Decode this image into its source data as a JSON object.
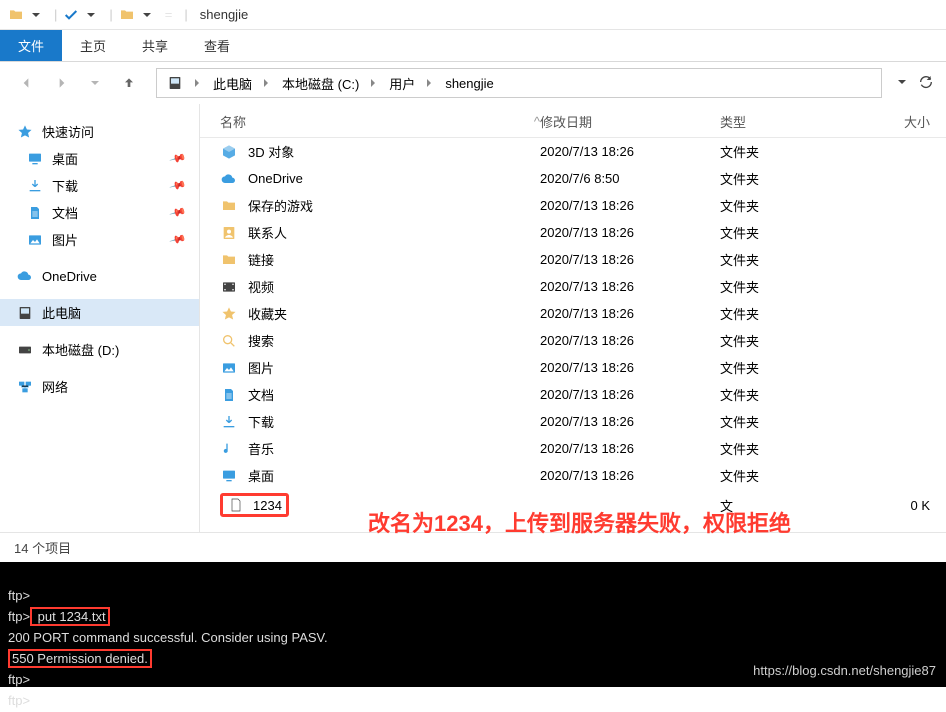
{
  "titlebar": {
    "title": "shengjie"
  },
  "tabs": {
    "file": "文件",
    "home": "主页",
    "share": "共享",
    "view": "查看"
  },
  "breadcrumb": {
    "segs": [
      "此电脑",
      "本地磁盘 (C:)",
      "用户",
      "shengjie"
    ]
  },
  "sidebar": {
    "quick": "快速访问",
    "pinned": {
      "desktop": "桌面",
      "downloads": "下载",
      "documents": "文档",
      "pictures": "图片"
    },
    "onedrive": "OneDrive",
    "thispc": "此电脑",
    "localdisk": "本地磁盘 (D:)",
    "network": "网络"
  },
  "columns": {
    "name": "名称",
    "date": "修改日期",
    "type": "类型",
    "size": "大小"
  },
  "rows": [
    {
      "icon": "cube",
      "name": "3D 对象",
      "date": "2020/7/13 18:26",
      "type": "文件夹"
    },
    {
      "icon": "cloud",
      "name": "OneDrive",
      "date": "2020/7/6 8:50",
      "type": "文件夹"
    },
    {
      "icon": "folder-g",
      "name": "保存的游戏",
      "date": "2020/7/13 18:26",
      "type": "文件夹"
    },
    {
      "icon": "contacts",
      "name": "联系人",
      "date": "2020/7/13 18:26",
      "type": "文件夹"
    },
    {
      "icon": "folder",
      "name": "链接",
      "date": "2020/7/13 18:26",
      "type": "文件夹"
    },
    {
      "icon": "video",
      "name": "视频",
      "date": "2020/7/13 18:26",
      "type": "文件夹"
    },
    {
      "icon": "star-f",
      "name": "收藏夹",
      "date": "2020/7/13 18:26",
      "type": "文件夹"
    },
    {
      "icon": "search-f",
      "name": "搜索",
      "date": "2020/7/13 18:26",
      "type": "文件夹"
    },
    {
      "icon": "picture",
      "name": "图片",
      "date": "2020/7/13 18:26",
      "type": "文件夹"
    },
    {
      "icon": "doc",
      "name": "文档",
      "date": "2020/7/13 18:26",
      "type": "文件夹"
    },
    {
      "icon": "download",
      "name": "下载",
      "date": "2020/7/13 18:26",
      "type": "文件夹"
    },
    {
      "icon": "music",
      "name": "音乐",
      "date": "2020/7/13 18:26",
      "type": "文件夹"
    },
    {
      "icon": "desktop",
      "name": "桌面",
      "date": "2020/7/13 18:26",
      "type": "文件夹"
    },
    {
      "icon": "file",
      "name": "1234",
      "date": "",
      "type": "文",
      "size": "0 K",
      "highlight": true
    }
  ],
  "annotation": "改名为1234，上传到服务器失败，权限拒绝",
  "status": "14 个项目",
  "terminal": {
    "l1": "ftp>",
    "l2a": "ftp>",
    "l2b": " put 1234.txt",
    "l3": "200 PORT command successful. Consider using PASV.",
    "l4": "550 Permission denied.",
    "l5": "ftp>",
    "l6": "ftp>"
  },
  "watermark": "https://blog.csdn.net/shengjie87"
}
